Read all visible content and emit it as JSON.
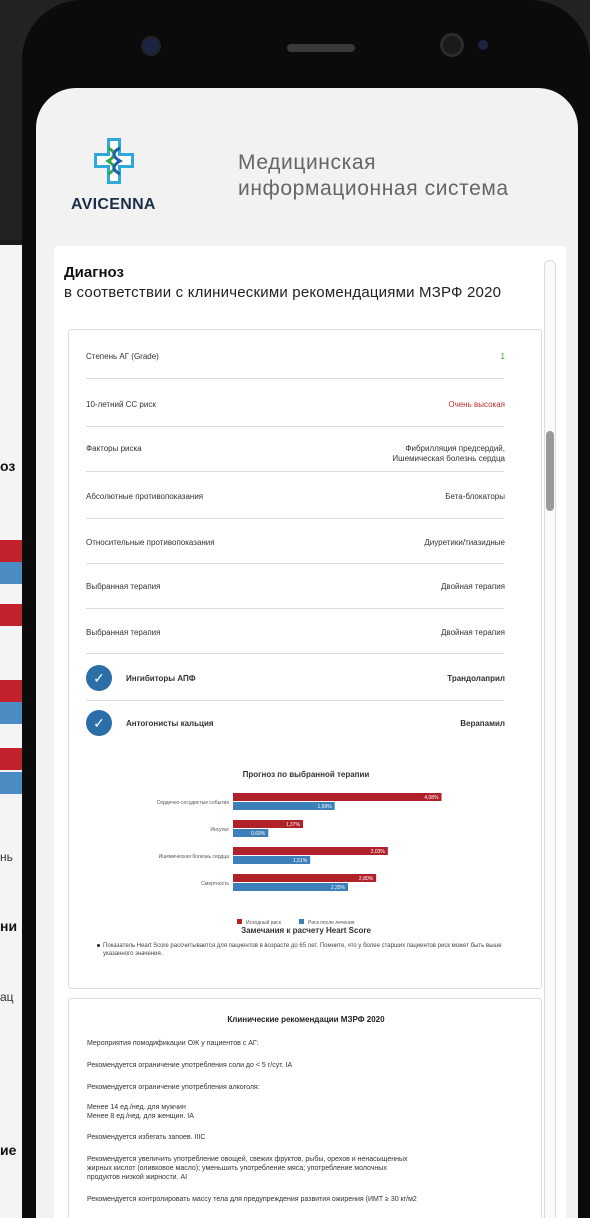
{
  "app": {
    "logo_text": "AVICENNA",
    "title_line1": "Медицинская",
    "title_line2": "информационная система"
  },
  "diagnosis": {
    "title": "Диагноз",
    "subtitle": "в соответствии с клиническими рекомендациями МЗРФ 2020",
    "rows": [
      {
        "label": "Степень АГ (Grade)",
        "value": "1",
        "value_color": "#3aa53a"
      },
      {
        "label": "10-летний СС риск",
        "value": "Очень высокая",
        "value_color": "#c0302a"
      },
      {
        "label": "Факторы риска",
        "value": "Фибрилляция предсердий,",
        "value2": "Ишемическая болезнь сердца"
      },
      {
        "label": "Абсолютные противопоказания",
        "value": "Бета-блокаторы"
      },
      {
        "label": "Относительные противопоказания",
        "value": "Диуретики/тиазидные"
      },
      {
        "label": "Выбранная терапия",
        "value": "Двойная терапия"
      },
      {
        "label": "Выбранная терапия",
        "value": "Двойная терапия"
      }
    ],
    "drugs": [
      {
        "label": "Ингибиторы АПФ",
        "value": "Трандолаприл"
      },
      {
        "label": "Антогонисты кальция",
        "value": "Верапамил"
      }
    ]
  },
  "chart_data": {
    "type": "bar",
    "title": "Прогноз по выбранной терапии",
    "orientation": "horizontal",
    "categories": [
      "Сердечно-сосудистые события",
      "Инсульт",
      "Ишемическая болезнь сердца",
      "Смертность"
    ],
    "series": [
      {
        "name": "Исходный риск",
        "color": "#b0212a",
        "values": [
          4.08,
          1.37,
          3.03,
          2.8
        ]
      },
      {
        "name": "Риск после лечения",
        "color": "#3d7fb8",
        "values": [
          1.99,
          0.69,
          1.51,
          2.25
        ]
      }
    ],
    "data_labels": [
      [
        "4,08%",
        "1,37%",
        "3,03%",
        "2,80%"
      ],
      [
        "1,99%",
        "0,69%",
        "1,51%",
        "2,25%"
      ]
    ],
    "xlim": [
      0,
      4.5
    ],
    "legend": "bottom"
  },
  "notes": {
    "title": "Замечания к расчету Heart Score",
    "text": "Показатель Heart Score рассчитывается для пациентов в возрасте до 65 лет. Помните, что у более старших пациентов риск может быть выше указанного значения."
  },
  "recommendations": {
    "title": "Клинические рекомендации МЗРФ 2020",
    "lines": [
      "Мероприятия помодификации ОЖ у пациентов с АГ:",
      "Рекомендуется ограничение употребления соли до < 5 г/сут. IA",
      "Рекомендуется ограничение употребления алкоголя:",
      "Менее 14 ед./нед. для мужчин",
      "Менее 8 ед./нед. для женщин. IA",
      "Рекомендуется избегать запоев. IIIC",
      "Рекомендуется увеличить употребление овощей, свежих фруктов, рыбы, орехов и ненасыщенных",
      "жирных кислот (оливковое масло); уменьшить употребление мяса; употребление молочных",
      "продуктов низкой жирности. AI",
      "Рекомендуется контролировать массу тела для предупреждения развития ожирения (ИМТ ≥ 30 кг/м2"
    ]
  },
  "background": {
    "left_texts": [
      "оз",
      "нь",
      "ни",
      "ац",
      "ие"
    ]
  }
}
